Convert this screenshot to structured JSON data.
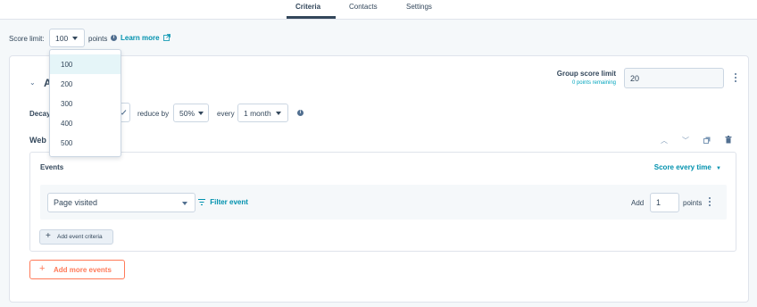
{
  "tabs": [
    {
      "label": "Criteria",
      "active": true
    },
    {
      "label": "Contacts",
      "active": false
    },
    {
      "label": "Settings",
      "active": false
    }
  ],
  "score_limit": {
    "label": "Score limit:",
    "value": "100",
    "points_label": "points",
    "learn_more": "Learn more",
    "options": [
      "100",
      "200",
      "300",
      "400",
      "500"
    ],
    "selected_option": "100"
  },
  "group": {
    "title_visible_fragment": "A",
    "score_limit_label": "Group score limit",
    "points_remaining": "0 points remaining",
    "score_limit_value": "20"
  },
  "decay": {
    "label": "Decay",
    "reduce_label": "reduce by",
    "percent": "50%",
    "every_label": "every",
    "period": "1 month"
  },
  "web": {
    "title": "Web",
    "events_title": "Events",
    "score_mode": "Score every time",
    "event": {
      "type": "Page visited",
      "filter_label": "Filter event",
      "add_label": "Add",
      "points": "1",
      "points_suffix": "points"
    },
    "add_criteria": "Add event criteria"
  },
  "add_more_events": "Add more events",
  "colors": {
    "accent": "#0091ae",
    "text": "#33475b",
    "orange": "#ff7a59",
    "border": "#cbd6e2",
    "background": "#f5f8fa"
  },
  "icons": {
    "info": "info-circle-icon",
    "external": "external-link-icon",
    "filter": "filter-icon",
    "up": "chevron-up-icon",
    "down": "chevron-down-icon",
    "clone": "clone-icon",
    "delete": "trash-icon",
    "more": "kebab-menu-icon"
  }
}
